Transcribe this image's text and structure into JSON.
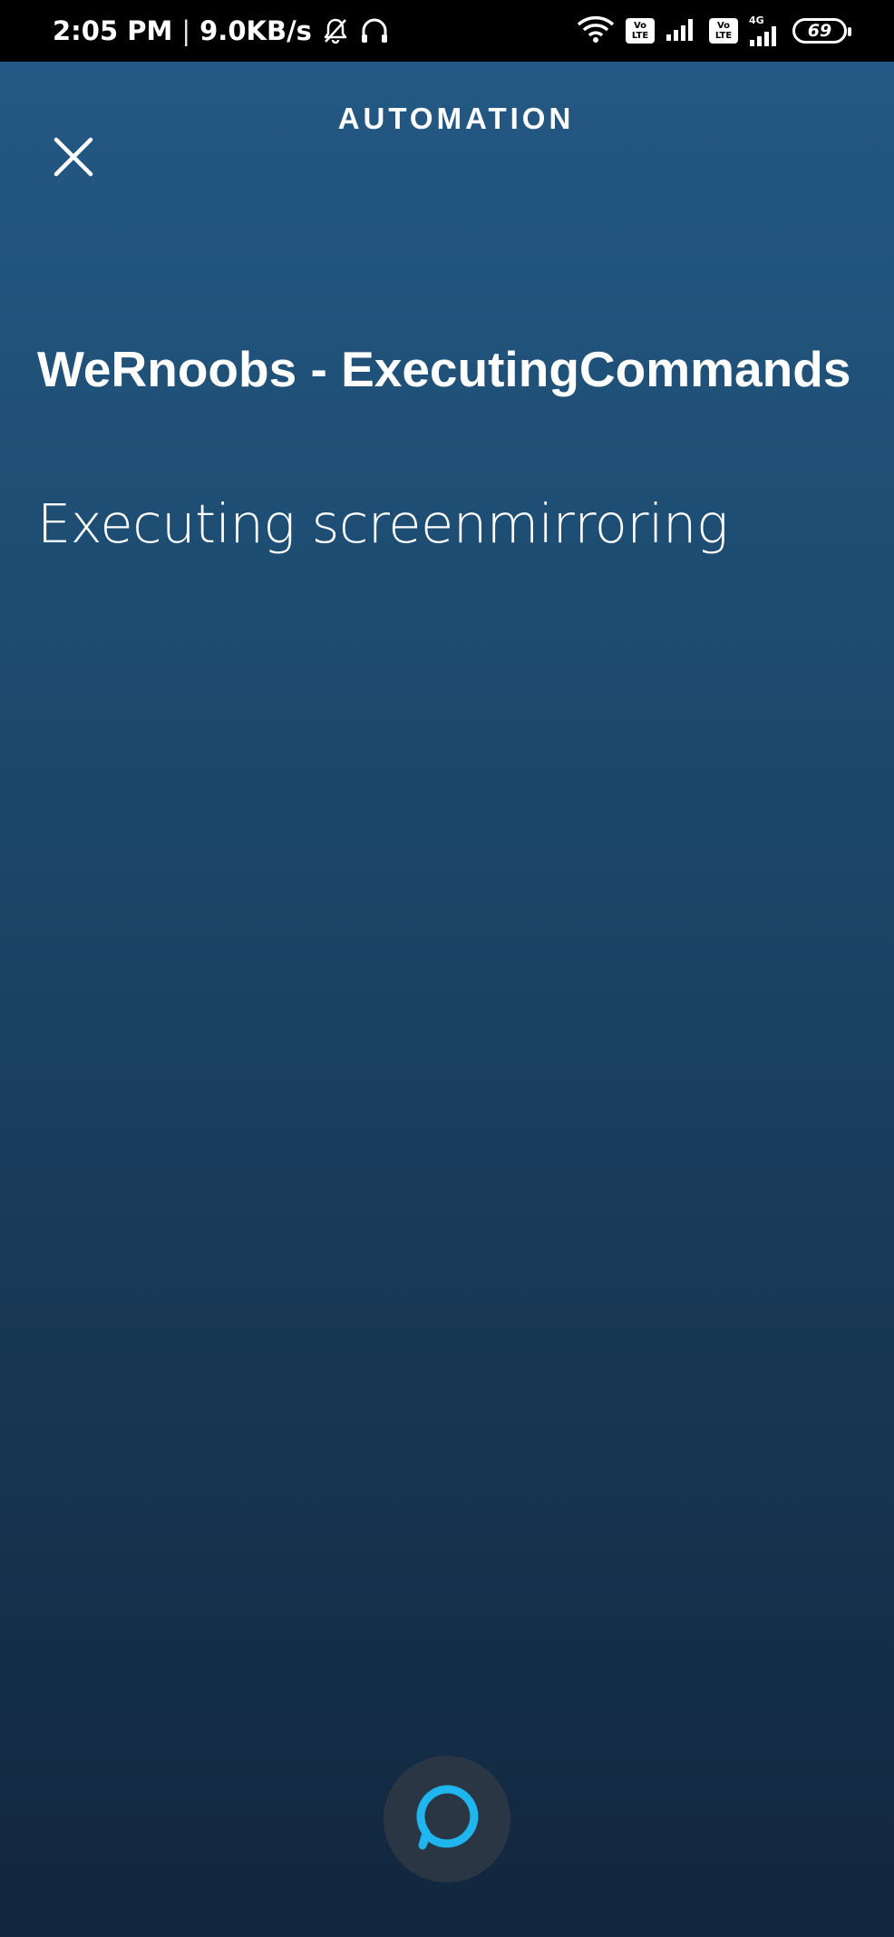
{
  "status_bar": {
    "time": "2:05 PM",
    "separator": "|",
    "speed": "9.0KB/s",
    "icons": [
      "bell-off-icon",
      "headset-icon",
      "wifi-icon",
      "volte-icon",
      "signal-icon",
      "volte-icon",
      "signal-4g-icon",
      "battery-icon"
    ],
    "volte_top": "Vo",
    "volte_bottom": "LTE",
    "network_type": "4G",
    "battery": "69"
  },
  "header": {
    "title": "AUTOMATION",
    "close_icon": "close-icon"
  },
  "main": {
    "title": "WeRnoobs - ExecutingCommands",
    "subtitle": "Executing screenmirroring"
  },
  "alexa_button": {
    "icon": "alexa-icon",
    "accent_color": "#1fb6f0"
  },
  "colors": {
    "background_top": "#245a86",
    "background_bottom": "#12263e",
    "status_bar": "#000000"
  }
}
